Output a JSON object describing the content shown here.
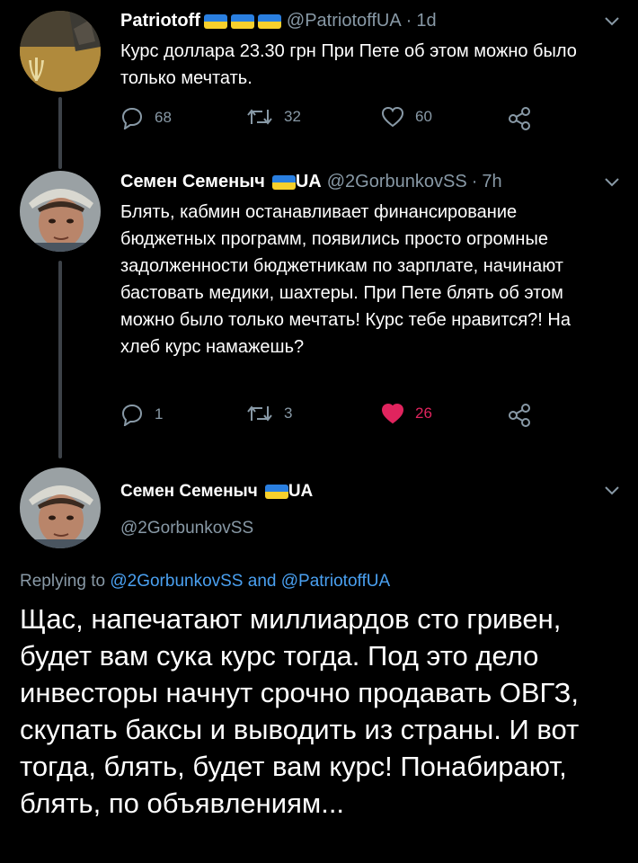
{
  "tweet1": {
    "name": "Patriotoff",
    "handle": "@PatriotoffUA",
    "time": "1d",
    "text": "Курс доллара 23.30 грн При Пете об этом можно было только мечтать.",
    "reply_count": "68",
    "retweet_count": "32",
    "like_count": "60"
  },
  "tweet2": {
    "name": "Семен Семеныч",
    "name_suffix": "UA",
    "handle": "@2GorbunkovSS",
    "time": "7h",
    "text": "Блять, кабмин останавливает финансирование бюджетных программ, появились просто огромные задолженности бюджетникам по зарплате, начинают бастовать медики, шахтеры. При Пете блять об этом можно было только мечтать! Курс тебе нравится?! На хлеб курс намажешь?",
    "reply_count": "1",
    "retweet_count": "3",
    "like_count": "26"
  },
  "tweet3": {
    "name": "Семен Семеныч",
    "name_suffix": "UA",
    "handle": "@2GorbunkovSS",
    "replying_prefix": "Replying to",
    "replying_user1": "@2GorbunkovSS",
    "replying_and": "and",
    "replying_user2": "@PatriotoffUA",
    "text": "Щас, напечатают миллиардов сто гривен, будет вам сука курс тогда. Под это дело инвесторы начнут срочно продавать ОВГЗ, скупать баксы и выводить из страны. И вот тогда, блять, будет вам курс! Понабирают, блять, по объявлениям..."
  },
  "colors": {
    "background": "#000000",
    "secondary_text": "#8899a6",
    "link": "#4aa0f0",
    "like_active": "#e0245e",
    "flag_blue": "#2a7fe0",
    "flag_yellow": "#f7d02c"
  }
}
